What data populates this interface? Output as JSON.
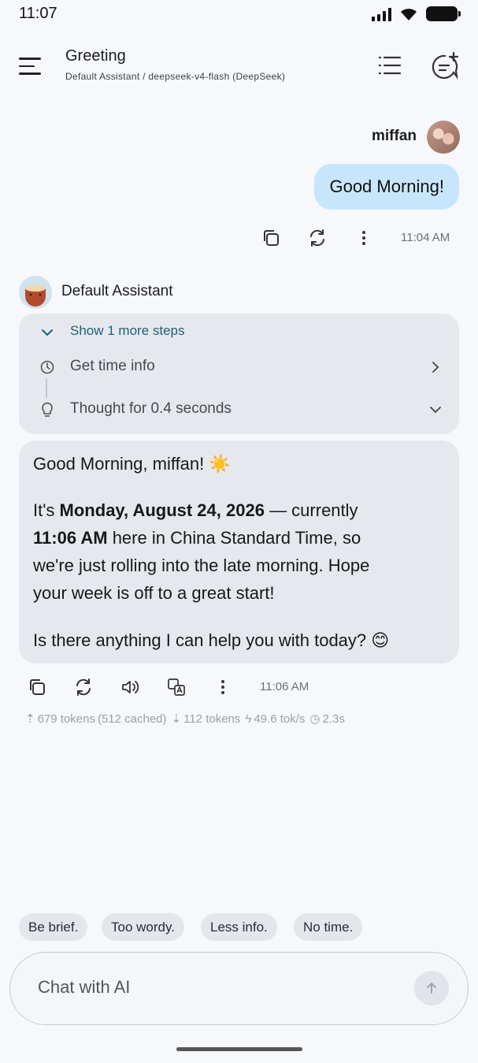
{
  "status_bar": {
    "time": "11:07"
  },
  "header": {
    "title": "Greeting",
    "subtitle": "Default Assistant / deepseek-v4-flash (DeepSeek)"
  },
  "user_message": {
    "name": "miffan",
    "text": "Good Morning!",
    "time": "11:04 AM"
  },
  "assistant_message": {
    "name": "Default Assistant",
    "steps_toggle": "Show 1 more steps",
    "steps": [
      {
        "label": "Get time info",
        "icon": "clock-icon"
      },
      {
        "label": "Thought for 0.4 seconds",
        "icon": "lightbulb-icon"
      }
    ],
    "greeting": "Good Morning, miffan! ☀️",
    "p1_pre": "It's ",
    "p1_date": "Monday, August 24, 2026",
    "p1_mid": " — currently",
    "p1_time": "11:06 AM",
    "p1_post": " here in China Standard Time, so",
    "p1_line3": "we're just rolling into the late morning. Hope",
    "p1_line4": "your week is off to a great start!",
    "closing": "Is there anything I can help you with today? 😊",
    "time": "11:06 AM",
    "stats": {
      "input_tokens": "679 tokens",
      "cached": "(512 cached)",
      "output_tokens": "112 tokens",
      "speed": "49.6 tok/s",
      "duration": "2.3s"
    }
  },
  "suggestions": [
    "Be brief.",
    "Too wordy.",
    "Less info.",
    "No time."
  ],
  "input": {
    "placeholder": "Chat with AI"
  },
  "colors": {
    "user_bubble": "#c8e6fb",
    "assistant_card": "#e5e9ed",
    "accent": "#1f5e7e"
  }
}
